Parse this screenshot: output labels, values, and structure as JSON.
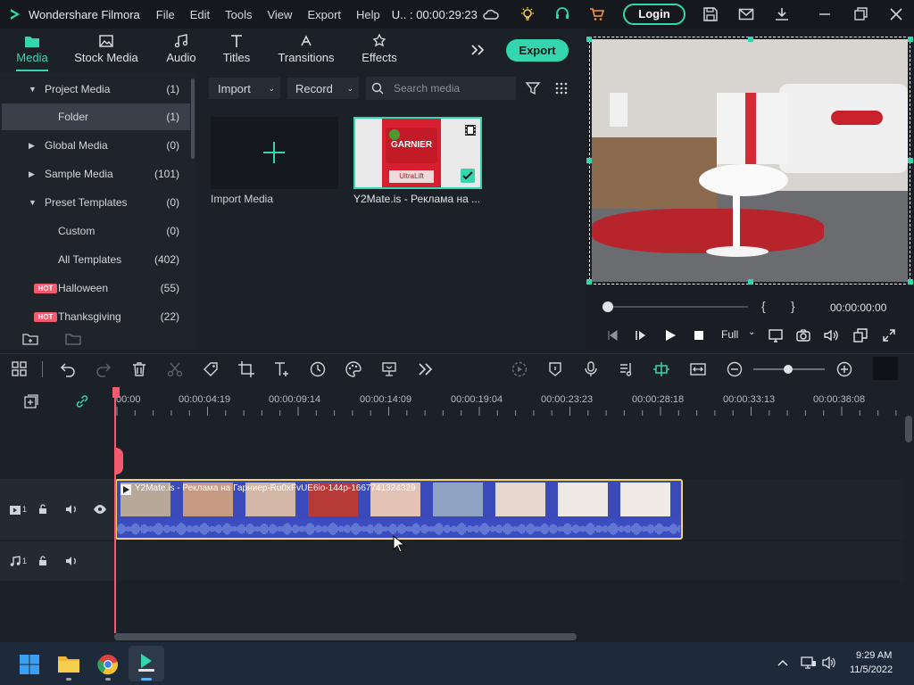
{
  "app": {
    "name": "Wondershare Filmora",
    "project": "U.. : 00:00:29:23",
    "login_label": "Login"
  },
  "menu": [
    "File",
    "Edit",
    "Tools",
    "View",
    "Export",
    "Help"
  ],
  "tabs": [
    {
      "label": "Media",
      "icon": "folder-media-icon",
      "active": true
    },
    {
      "label": "Stock Media",
      "icon": "image-icon"
    },
    {
      "label": "Audio",
      "icon": "music-note-icon"
    },
    {
      "label": "Titles",
      "icon": "text-t-icon"
    },
    {
      "label": "Transitions",
      "icon": "transition-icon"
    },
    {
      "label": "Effects",
      "icon": "effects-icon"
    }
  ],
  "export_label": "Export",
  "left_panel": {
    "items": [
      {
        "label": "Project Media",
        "count": "(1)",
        "arrow": "down"
      },
      {
        "label": "Folder",
        "count": "(1)",
        "selected": true
      },
      {
        "label": "Global Media",
        "count": "(0)",
        "arrow": "right"
      },
      {
        "label": "Sample Media",
        "count": "(101)",
        "arrow": "right"
      },
      {
        "label": "Preset Templates",
        "count": "(0)",
        "arrow": "down"
      },
      {
        "label": "Custom",
        "count": "(0)"
      },
      {
        "label": "All Templates",
        "count": "(402)"
      },
      {
        "label": "Halloween",
        "count": "(55)",
        "hot": "HOT"
      },
      {
        "label": "Thanksgiving",
        "count": "(22)",
        "hot": "HOT"
      }
    ]
  },
  "media": {
    "import_label": "Import",
    "record_label": "Record",
    "search_placeholder": "Search media",
    "import_media_label": "Import Media",
    "clip_name": "Y2Mate.is - Реклама на ...",
    "thumb_brand": "GARNIER",
    "thumb_product": "UltraLift"
  },
  "preview": {
    "timecode": "00:00:00:00",
    "quality": "Full",
    "mark_in": "{",
    "mark_out": "}"
  },
  "timeline": {
    "ruler_labels": [
      "00:00",
      "00:00:04:19",
      "00:00:09:14",
      "00:00:14:09",
      "00:00:19:04",
      "00:00:23:23",
      "00:00:28:18",
      "00:00:33:13",
      "00:00:38:08"
    ],
    "video_track": "1",
    "audio_track": "1",
    "clip_title": "Y2Mate.is - Реклама на Гарниер-Ru0xFvUE6io-144p-1667741324329"
  },
  "taskbar": {
    "time": "9:29 AM",
    "date": "11/5/2022"
  },
  "colors": {
    "accent": "#34d6b0",
    "playhead": "#f25b6e",
    "clip_border": "#f3d36b",
    "hot_badge": "#f25b6e"
  }
}
